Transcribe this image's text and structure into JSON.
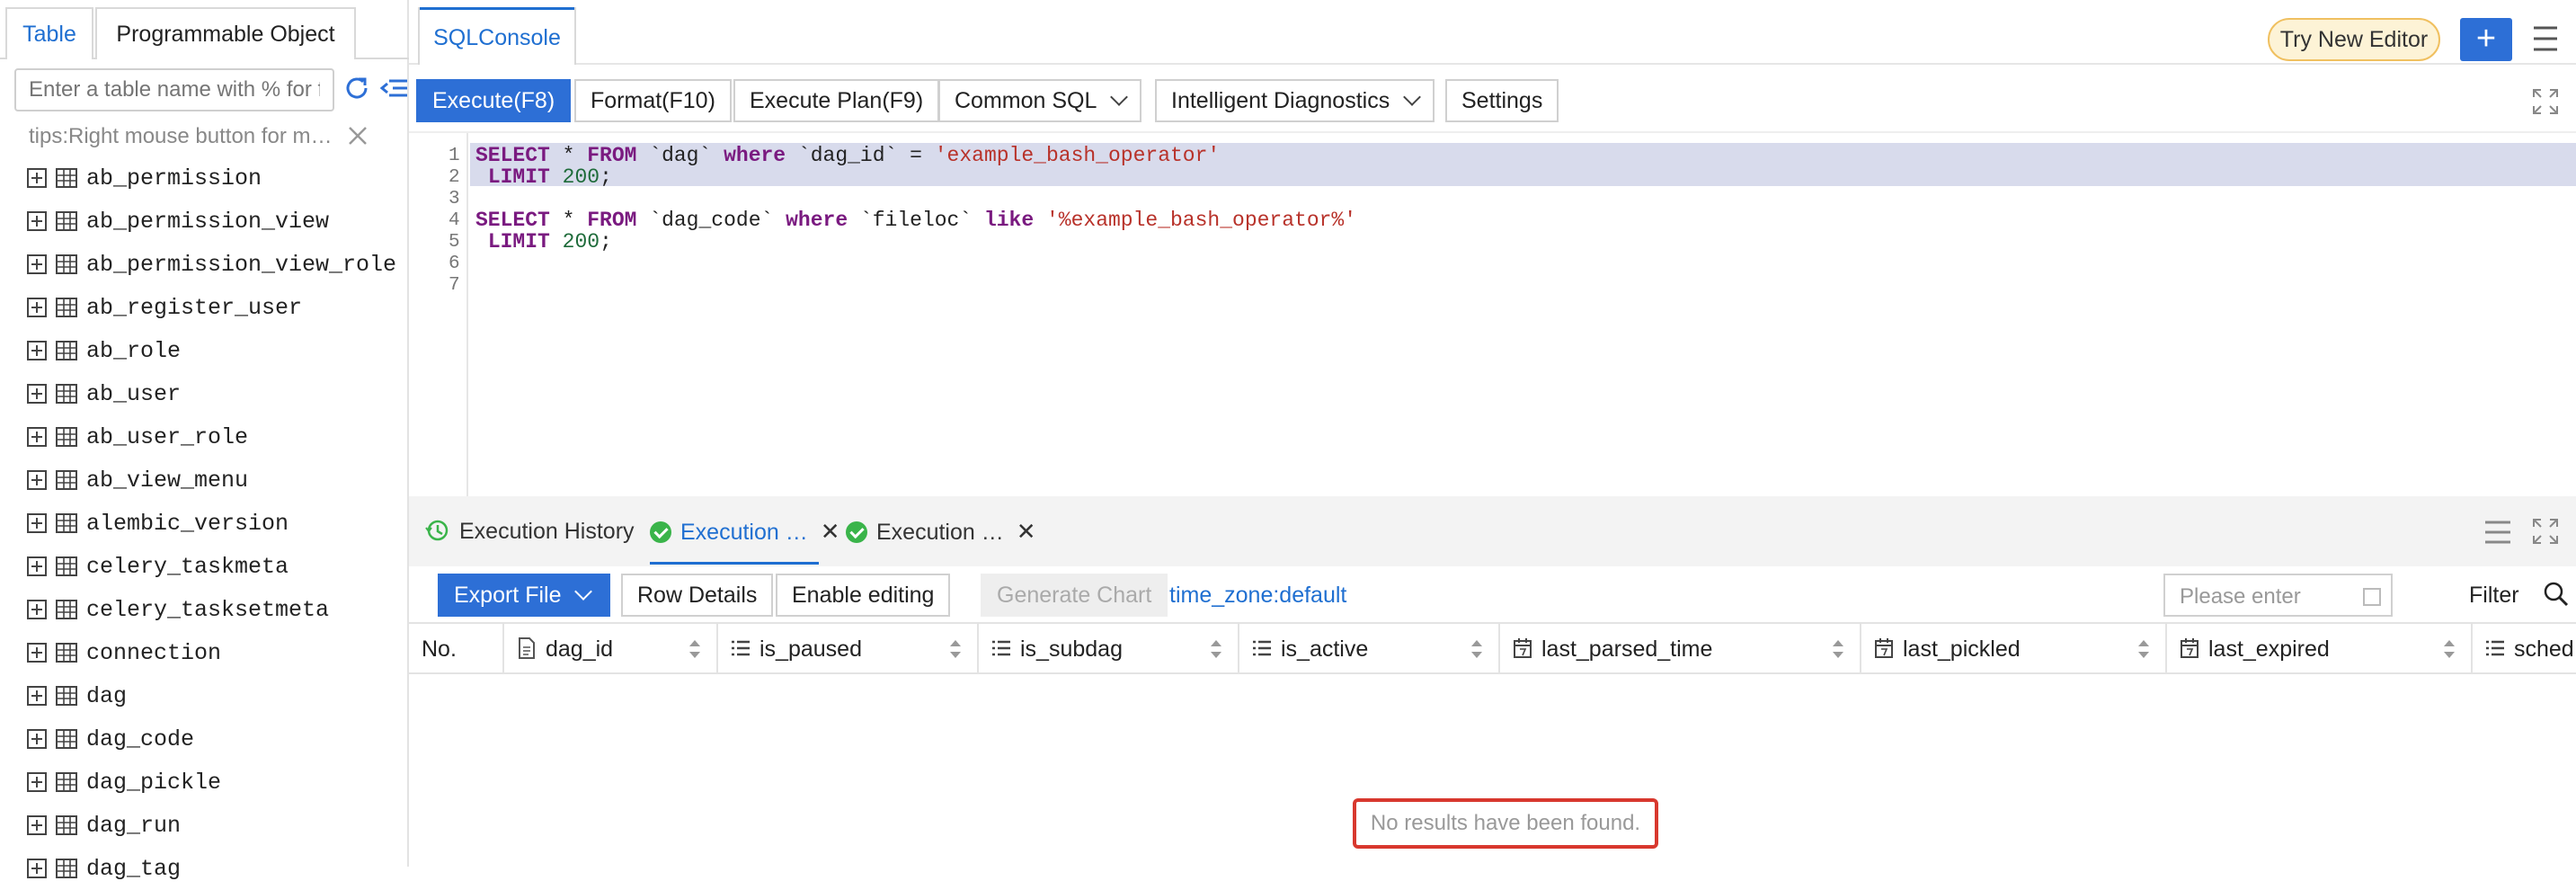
{
  "left_panel": {
    "tabs": [
      "Table",
      "Programmable Object"
    ],
    "search_placeholder": "Enter a table name with % for f",
    "tips": "tips:Right mouse button for m…",
    "tables": [
      "ab_permission",
      "ab_permission_view",
      "ab_permission_view_role",
      "ab_register_user",
      "ab_role",
      "ab_user",
      "ab_user_role",
      "ab_view_menu",
      "alembic_version",
      "celery_taskmeta",
      "celery_tasksetmeta",
      "connection",
      "dag",
      "dag_code",
      "dag_pickle",
      "dag_run",
      "dag_tag"
    ]
  },
  "header": {
    "console_tab": "SQLConsole",
    "try_new_editor": "Try New Editor",
    "add_label": "+"
  },
  "toolbar": {
    "execute": "Execute(F8)",
    "format": "Format(F10)",
    "execute_plan": "Execute Plan(F9)",
    "common_sql": "Common SQL",
    "intelligent_diagnostics": "Intelligent Diagnostics",
    "settings": "Settings"
  },
  "editor": {
    "line_numbers": [
      "1",
      "2",
      "3",
      "4",
      "5",
      "6",
      "7"
    ],
    "highlighted_lines": [
      1,
      2
    ]
  },
  "results": {
    "tabs": {
      "history": "Execution History",
      "exec1": "Execution …",
      "exec2": "Execution …"
    },
    "buttons": {
      "export": "Export File",
      "row_details": "Row Details",
      "enable_editing": "Enable editing",
      "generate_chart": "Generate Chart"
    },
    "timezone": "time_zone:default",
    "filter_placeholder": "Please enter",
    "filter_label": "Filter",
    "columns": {
      "no": "No.",
      "dag_id": "dag_id",
      "is_paused": "is_paused",
      "is_subdag": "is_subdag",
      "is_active": "is_active",
      "last_parsed_time": "last_parsed_time",
      "last_pickled": "last_pickled",
      "last_expired": "last_expired",
      "sched": "sched"
    },
    "empty_message": "No results have been found."
  },
  "colors": {
    "accent": "#2d6fd6",
    "success": "#3ab44a",
    "highlight_border": "#d8382e"
  }
}
